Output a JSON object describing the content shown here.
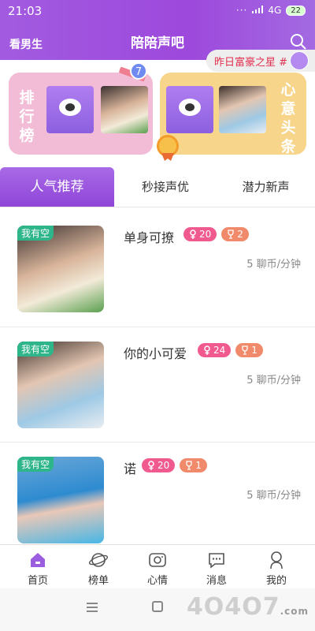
{
  "status_bar": {
    "time": "21:03",
    "signal": "4G",
    "battery": "22",
    "dots": "···"
  },
  "header": {
    "left_label": "看男生",
    "title": "陪陪声吧"
  },
  "marquee": {
    "text": "昨日富豪之星 #"
  },
  "cards": {
    "rank": {
      "label": "排行榜",
      "badge_number": "7"
    },
    "heart": {
      "label": "心意头条"
    }
  },
  "tabs": [
    {
      "label": "人气推荐",
      "active": true
    },
    {
      "label": "秒接声优",
      "active": false
    },
    {
      "label": "潜力新声",
      "active": false
    }
  ],
  "list": [
    {
      "free_tag": "我有空",
      "name": "单身可撩",
      "likes": "20",
      "trophies": "2",
      "price": "5 聊币/分钟"
    },
    {
      "free_tag": "我有空",
      "name": "你的小可爱",
      "likes": "24",
      "trophies": "1",
      "price": "5 聊币/分钟"
    },
    {
      "free_tag": "我有空",
      "name": "诺",
      "likes": "20",
      "trophies": "1",
      "price": "5 聊币/分钟"
    }
  ],
  "bottom_nav": [
    {
      "label": "首页",
      "icon": "home-icon",
      "active": true
    },
    {
      "label": "榜单",
      "icon": "planet-icon",
      "active": false
    },
    {
      "label": "心情",
      "icon": "camera-icon",
      "active": false
    },
    {
      "label": "消息",
      "icon": "chat-icon",
      "active": false
    },
    {
      "label": "我的",
      "icon": "profile-icon",
      "active": false
    }
  ],
  "watermark": {
    "text": "4O4O7",
    "sub": ".com"
  },
  "colors": {
    "header": "#9d49dc",
    "accent_pink": "#f05a8f",
    "free_tag": "#2fb58a",
    "rank_card": "#f2bbd6",
    "heart_card": "#f7d58a"
  }
}
